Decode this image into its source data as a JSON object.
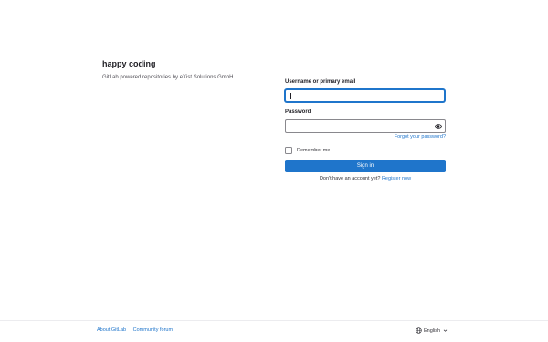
{
  "brand": {
    "title": "happy coding",
    "description": "GitLab powered repositories by eXist Solutions GmbH"
  },
  "login": {
    "username_label": "Username or primary email",
    "username_value": "",
    "password_label": "Password",
    "password_value": "",
    "forgot_password": "Forgot your password?",
    "remember_me": "Remember me",
    "remember_checked": false,
    "sign_in": "Sign in",
    "no_account_text": "Don't have an account yet?",
    "register_link": "Register now"
  },
  "footer": {
    "links": [
      "About GitLab",
      "Community forum"
    ],
    "language": "English"
  },
  "colors": {
    "accent": "#1f75cb",
    "text": "#333238",
    "border": "#89888d"
  },
  "icons": {
    "password_toggle": "eye-icon",
    "language": "globe-icon",
    "language_menu": "chevron-down-icon"
  }
}
